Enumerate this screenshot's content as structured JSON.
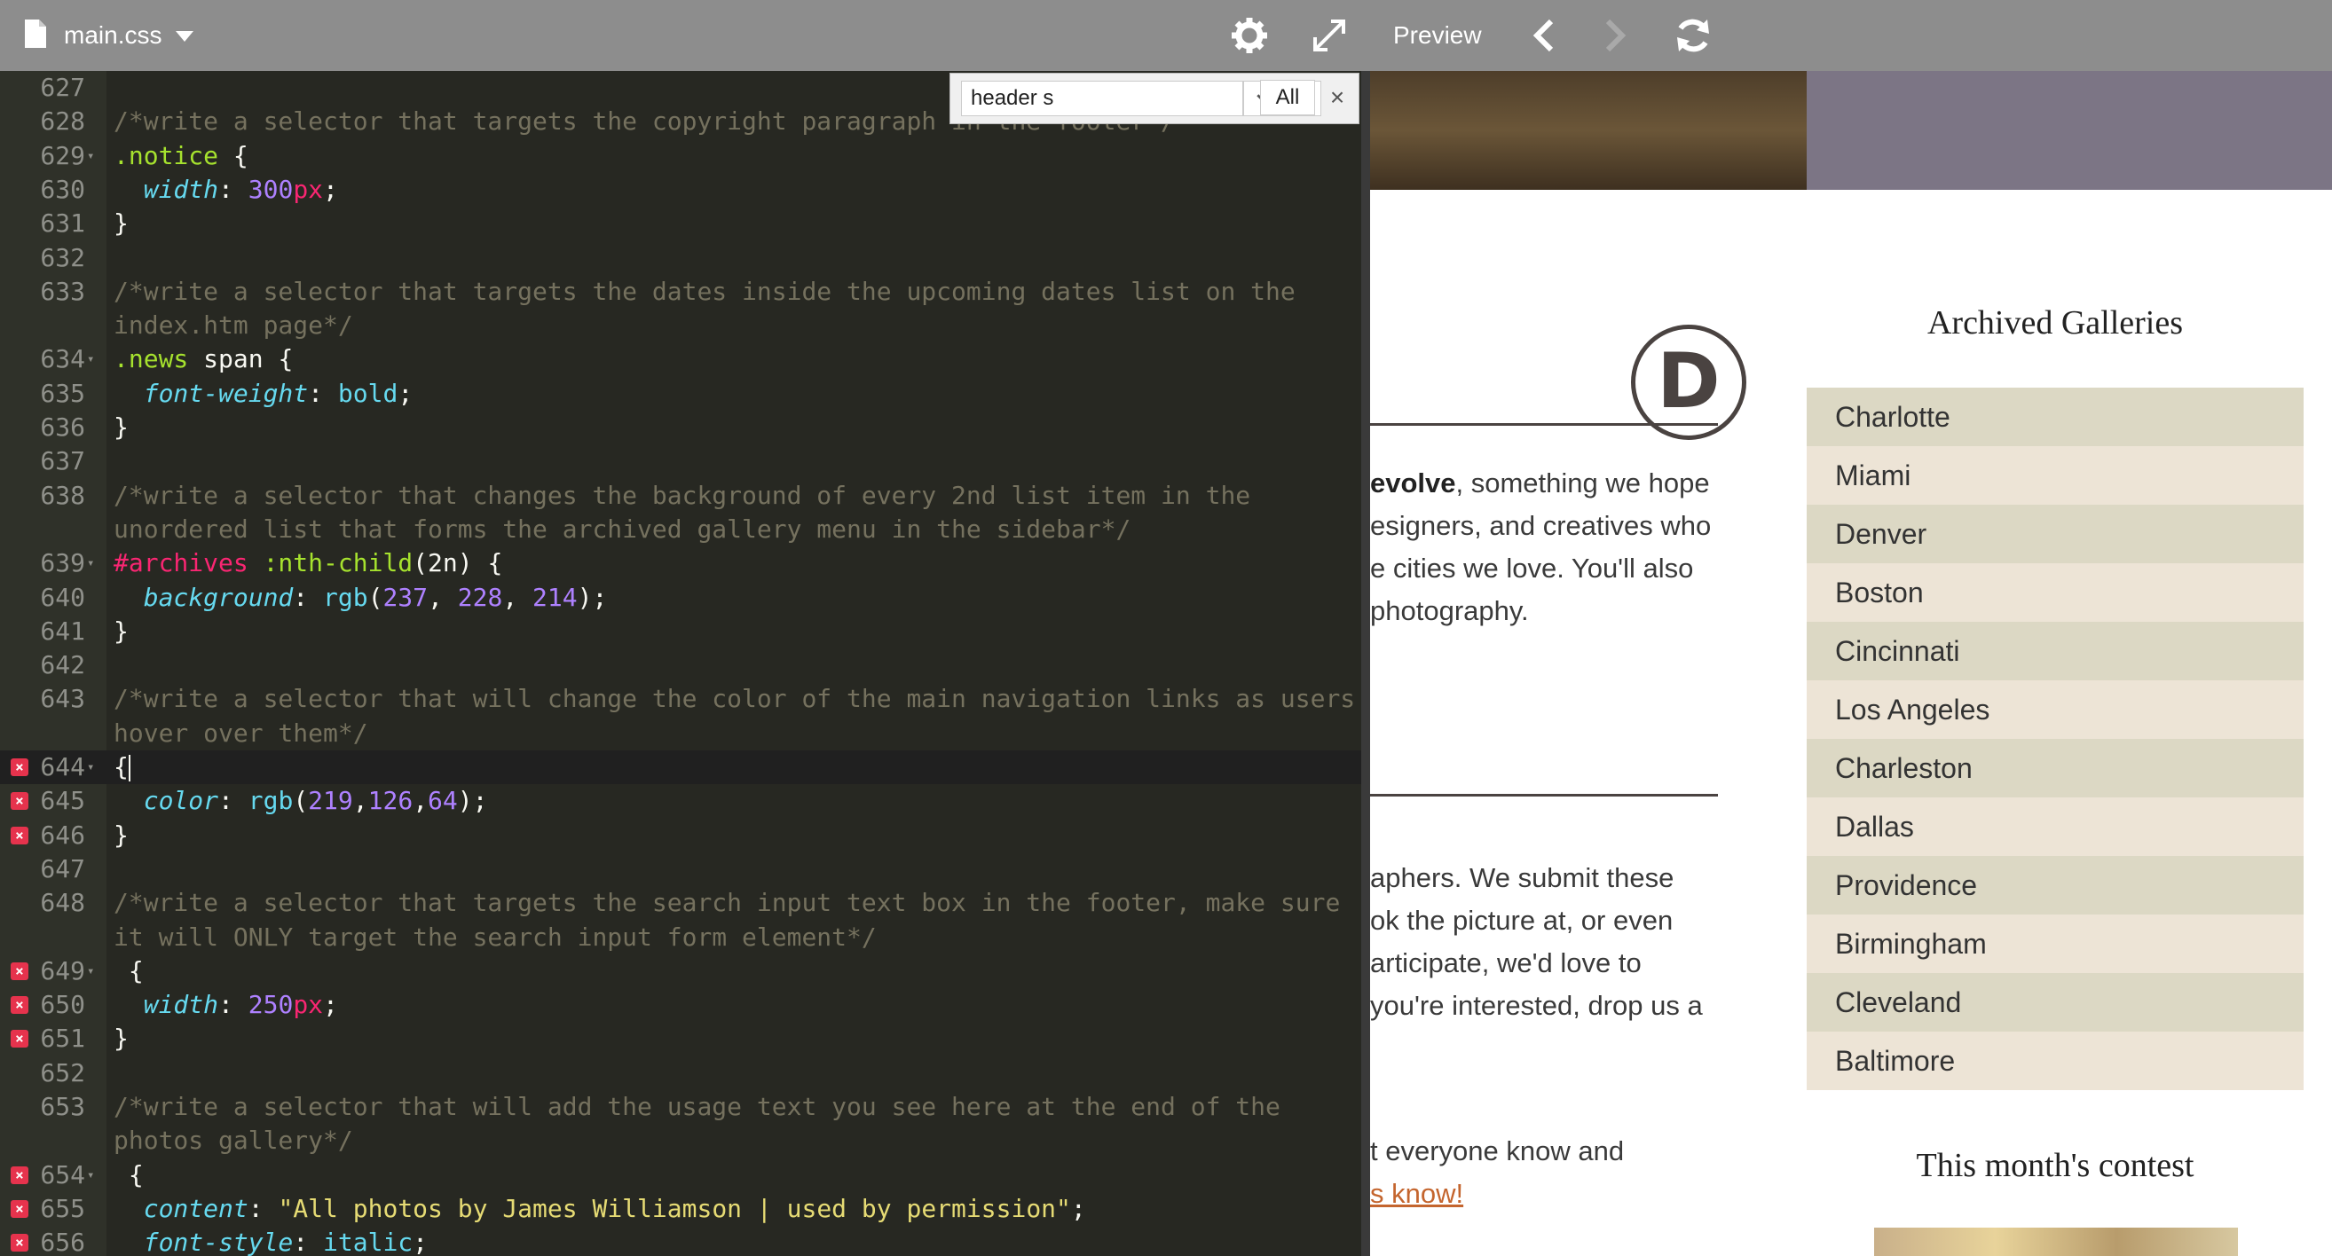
{
  "editor": {
    "file_name": "main.css",
    "lines": [
      {
        "n": "627",
        "fold": false,
        "error": false,
        "active": false,
        "tokens": []
      },
      {
        "n": "628",
        "fold": false,
        "error": false,
        "active": false,
        "tokens": [
          [
            "c-cm",
            "/*write a selector that targets the copyright paragraph in the footer*/"
          ]
        ]
      },
      {
        "n": "629",
        "fold": true,
        "error": false,
        "active": false,
        "tokens": [
          [
            "c-sel",
            ".notice"
          ],
          [
            "",
            " {"
          ]
        ]
      },
      {
        "n": "630",
        "fold": false,
        "error": false,
        "active": false,
        "tokens": [
          [
            "",
            "  "
          ],
          [
            "c-prop",
            "width"
          ],
          [
            "",
            ": "
          ],
          [
            "c-num",
            "300"
          ],
          [
            "c-unit",
            "px"
          ],
          [
            "",
            ";"
          ]
        ]
      },
      {
        "n": "631",
        "fold": false,
        "error": false,
        "active": false,
        "tokens": [
          [
            "",
            "}"
          ]
        ]
      },
      {
        "n": "632",
        "fold": false,
        "error": false,
        "active": false,
        "tokens": []
      },
      {
        "n": "633",
        "fold": false,
        "error": false,
        "active": false,
        "tokens": [
          [
            "c-cm",
            "/*write a selector that targets the dates inside the upcoming dates list on the"
          ]
        ]
      },
      {
        "n": "",
        "fold": false,
        "error": false,
        "active": false,
        "tokens": [
          [
            "c-cm",
            "index.htm page*/"
          ]
        ]
      },
      {
        "n": "634",
        "fold": true,
        "error": false,
        "active": false,
        "tokens": [
          [
            "c-sel",
            ".news"
          ],
          [
            "",
            " span {"
          ]
        ]
      },
      {
        "n": "635",
        "fold": false,
        "error": false,
        "active": false,
        "tokens": [
          [
            "",
            "  "
          ],
          [
            "c-prop",
            "font-weight"
          ],
          [
            "",
            ": "
          ],
          [
            "c-kw",
            "bold"
          ],
          [
            "",
            ";"
          ]
        ]
      },
      {
        "n": "636",
        "fold": false,
        "error": false,
        "active": false,
        "tokens": [
          [
            "",
            "}"
          ]
        ]
      },
      {
        "n": "637",
        "fold": false,
        "error": false,
        "active": false,
        "tokens": []
      },
      {
        "n": "638",
        "fold": false,
        "error": false,
        "active": false,
        "tokens": [
          [
            "c-cm",
            "/*write a selector that changes the background of every 2nd list item in the"
          ]
        ]
      },
      {
        "n": "",
        "fold": false,
        "error": false,
        "active": false,
        "tokens": [
          [
            "c-cm",
            "unordered list that forms the archived gallery menu in the sidebar*/"
          ]
        ]
      },
      {
        "n": "639",
        "fold": true,
        "error": false,
        "active": false,
        "tokens": [
          [
            "c-id",
            "#archives"
          ],
          [
            "",
            " "
          ],
          [
            "c-sel",
            ":nth-child"
          ],
          [
            "",
            "(2n) {"
          ]
        ]
      },
      {
        "n": "640",
        "fold": false,
        "error": false,
        "active": false,
        "tokens": [
          [
            "",
            "  "
          ],
          [
            "c-prop",
            "background"
          ],
          [
            "",
            ": "
          ],
          [
            "c-fn",
            "rgb"
          ],
          [
            "",
            "("
          ],
          [
            "c-num",
            "237"
          ],
          [
            "",
            ", "
          ],
          [
            "c-num",
            "228"
          ],
          [
            "",
            ", "
          ],
          [
            "c-num",
            "214"
          ],
          [
            "",
            ");"
          ]
        ]
      },
      {
        "n": "641",
        "fold": false,
        "error": false,
        "active": false,
        "tokens": [
          [
            "",
            "}"
          ]
        ]
      },
      {
        "n": "642",
        "fold": false,
        "error": false,
        "active": false,
        "tokens": []
      },
      {
        "n": "643",
        "fold": false,
        "error": false,
        "active": false,
        "tokens": [
          [
            "c-cm",
            "/*write a selector that will change the color of the main navigation links as users"
          ]
        ]
      },
      {
        "n": "",
        "fold": false,
        "error": false,
        "active": false,
        "tokens": [
          [
            "c-cm",
            "hover over them*/"
          ]
        ]
      },
      {
        "n": "644",
        "fold": true,
        "error": true,
        "active": true,
        "tokens": [
          [
            "",
            "{"
          ],
          [
            "cursor",
            ""
          ]
        ]
      },
      {
        "n": "645",
        "fold": false,
        "error": true,
        "active": false,
        "tokens": [
          [
            "",
            "  "
          ],
          [
            "c-prop",
            "color"
          ],
          [
            "",
            ": "
          ],
          [
            "c-fn",
            "rgb"
          ],
          [
            "",
            "("
          ],
          [
            "c-num",
            "219"
          ],
          [
            "",
            ","
          ],
          [
            "c-num",
            "126"
          ],
          [
            "",
            ","
          ],
          [
            "c-num",
            "64"
          ],
          [
            "",
            ");"
          ]
        ]
      },
      {
        "n": "646",
        "fold": false,
        "error": true,
        "active": false,
        "tokens": [
          [
            "",
            "}"
          ]
        ]
      },
      {
        "n": "647",
        "fold": false,
        "error": false,
        "active": false,
        "tokens": []
      },
      {
        "n": "648",
        "fold": false,
        "error": false,
        "active": false,
        "tokens": [
          [
            "c-cm",
            "/*write a selector that targets the search input text box in the footer, make sure"
          ]
        ]
      },
      {
        "n": "",
        "fold": false,
        "error": false,
        "active": false,
        "tokens": [
          [
            "c-cm",
            "it will ONLY target the search input form element*/"
          ]
        ]
      },
      {
        "n": "649",
        "fold": true,
        "error": true,
        "active": false,
        "tokens": [
          [
            "",
            " {"
          ]
        ]
      },
      {
        "n": "650",
        "fold": false,
        "error": true,
        "active": false,
        "tokens": [
          [
            "",
            "  "
          ],
          [
            "c-prop",
            "width"
          ],
          [
            "",
            ": "
          ],
          [
            "c-num",
            "250"
          ],
          [
            "c-unit",
            "px"
          ],
          [
            "",
            ";"
          ]
        ]
      },
      {
        "n": "651",
        "fold": false,
        "error": true,
        "active": false,
        "tokens": [
          [
            "",
            "}"
          ]
        ]
      },
      {
        "n": "652",
        "fold": false,
        "error": false,
        "active": false,
        "tokens": []
      },
      {
        "n": "653",
        "fold": false,
        "error": false,
        "active": false,
        "tokens": [
          [
            "c-cm",
            "/*write a selector that will add the usage text you see here at the end of the"
          ]
        ]
      },
      {
        "n": "",
        "fold": false,
        "error": false,
        "active": false,
        "tokens": [
          [
            "c-cm",
            "photos gallery*/"
          ]
        ]
      },
      {
        "n": "654",
        "fold": true,
        "error": true,
        "active": false,
        "tokens": [
          [
            "",
            " {"
          ]
        ]
      },
      {
        "n": "655",
        "fold": false,
        "error": true,
        "active": false,
        "tokens": [
          [
            "",
            "  "
          ],
          [
            "c-prop",
            "content"
          ],
          [
            "",
            ": "
          ],
          [
            "c-str",
            "\"All photos by James Williamson | used by permission\""
          ],
          [
            "",
            ";"
          ]
        ]
      },
      {
        "n": "656",
        "fold": false,
        "error": true,
        "active": false,
        "tokens": [
          [
            "",
            "  "
          ],
          [
            "c-prop",
            "font-style"
          ],
          [
            "",
            ": "
          ],
          [
            "c-kw",
            "italic"
          ],
          [
            "",
            ";"
          ]
        ]
      }
    ]
  },
  "search": {
    "query": "header s",
    "all_label": "All",
    "close_label": "×"
  },
  "preview": {
    "label": "Preview",
    "logo_letter": "D",
    "text_blocks": [
      [
        "<b>evolve</b>, something we hope",
        "esigners, and creatives who",
        "e cities we love. You'll also",
        " photography."
      ],
      [
        "aphers. We submit these",
        "ok the picture at, or even",
        "articipate, we'd love to",
        " you're interested, drop us a"
      ],
      [
        "t everyone know and",
        "<a>s know!</a>"
      ]
    ],
    "sidebar": {
      "title": "Archived Galleries",
      "galleries": [
        "Charlotte",
        "Miami",
        "Denver",
        "Boston",
        "Cincinnati",
        "Los Angeles",
        "Charleston",
        "Dallas",
        "Providence",
        "Birmingham",
        "Cleveland",
        "Baltimore"
      ],
      "contest_title": "This month's contest"
    }
  },
  "colors": {
    "toolbar": "#8d8d8d",
    "editor_bg": "#272822",
    "gallery_odd": "#dcd8c4",
    "gallery_even": "#ede4d6",
    "link": "#c4652e"
  },
  "icons": [
    "file-icon",
    "chevron-down-icon",
    "gear-icon",
    "expand-icon",
    "chevron-left-icon",
    "chevron-right-icon",
    "refresh-icon",
    "close-icon",
    "error-icon"
  ]
}
